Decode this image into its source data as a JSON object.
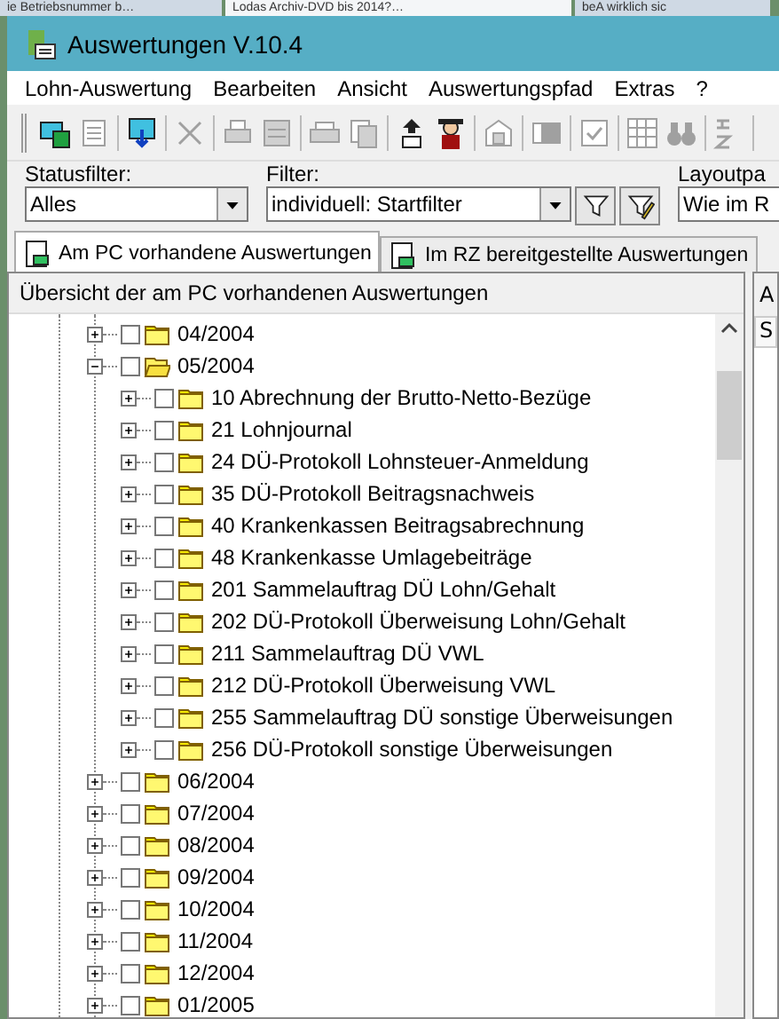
{
  "browser_tabs": [
    {
      "title": "ie Betriebsnummer b…",
      "selected": false
    },
    {
      "title": "Lodas Archiv-DVD bis 2014?…",
      "selected": true
    },
    {
      "title": "beA wirklich sic",
      "selected": false
    }
  ],
  "window": {
    "title": "Auswertungen V.10.4"
  },
  "menu": [
    "Lohn-Auswertung",
    "Bearbeiten",
    "Ansicht",
    "Auswertungspfad",
    "Extras",
    "?"
  ],
  "toolbar": [
    [
      {
        "disabled": false
      },
      {
        "disabled": true
      }
    ],
    [
      {
        "disabled": false
      }
    ],
    [
      {
        "disabled": true
      }
    ],
    [
      {
        "disabled": true
      },
      {
        "disabled": true
      }
    ],
    [
      {
        "disabled": true
      },
      {
        "disabled": true
      }
    ],
    [
      {
        "disabled": false
      },
      {
        "disabled": false
      }
    ],
    [
      {
        "disabled": true
      }
    ],
    [
      {
        "disabled": true
      }
    ],
    [
      {
        "disabled": true
      }
    ],
    [
      {
        "disabled": true
      },
      {
        "disabled": true
      }
    ],
    [
      {
        "disabled": true
      }
    ]
  ],
  "filters": [
    {
      "label": "Statusfilter:",
      "value": "Alles",
      "kind": "combo"
    },
    {
      "label": "Filter:",
      "value": "individuell: Startfilter",
      "kind": "combo-buttons"
    },
    {
      "label": "Layoutpa",
      "value": "Wie im R",
      "kind": "cut"
    }
  ],
  "tabs": [
    {
      "label": "Am PC vorhandene Auswertungen",
      "selected": true
    },
    {
      "label": "Im RZ bereitgestellte Auswertungen",
      "selected": false
    }
  ],
  "tree": {
    "title": "Übersicht der am PC vorhandenen Auswertungen",
    "items": [
      {
        "label": "04/2004",
        "expanded": false,
        "checked": false
      },
      {
        "label": "05/2004",
        "expanded": true,
        "checked": false,
        "children": [
          {
            "label": "10 Abrechnung der Brutto-Netto-Bezüge",
            "expanded": false,
            "checked": false
          },
          {
            "label": "21 Lohnjournal",
            "expanded": false,
            "checked": false
          },
          {
            "label": "24 DÜ-Protokoll Lohnsteuer-Anmeldung",
            "expanded": false,
            "checked": false
          },
          {
            "label": "35 DÜ-Protokoll Beitragsnachweis",
            "expanded": false,
            "checked": false
          },
          {
            "label": "40 Krankenkassen Beitragsabrechnung",
            "expanded": false,
            "checked": false
          },
          {
            "label": "48 Krankenkasse Umlagebeiträge",
            "expanded": false,
            "checked": false
          },
          {
            "label": "201 Sammelauftrag DÜ Lohn/Gehalt",
            "expanded": false,
            "checked": false
          },
          {
            "label": "202 DÜ-Protokoll Überweisung Lohn/Gehalt",
            "expanded": false,
            "checked": false
          },
          {
            "label": "211 Sammelauftrag DÜ VWL",
            "expanded": false,
            "checked": false
          },
          {
            "label": "212 DÜ-Protokoll Überweisung VWL",
            "expanded": false,
            "checked": false
          },
          {
            "label": "255 Sammelauftrag DÜ sonstige Überweisungen",
            "expanded": false,
            "checked": false
          },
          {
            "label": "256 DÜ-Protokoll sonstige Überweisungen",
            "expanded": false,
            "checked": false
          }
        ]
      },
      {
        "label": "06/2004",
        "expanded": false,
        "checked": false
      },
      {
        "label": "07/2004",
        "expanded": false,
        "checked": false
      },
      {
        "label": "08/2004",
        "expanded": false,
        "checked": false
      },
      {
        "label": "09/2004",
        "expanded": false,
        "checked": false
      },
      {
        "label": "10/2004",
        "expanded": false,
        "checked": false
      },
      {
        "label": "11/2004",
        "expanded": false,
        "checked": false
      },
      {
        "label": "12/2004",
        "expanded": false,
        "checked": false
      },
      {
        "label": "01/2005",
        "expanded": false,
        "checked": false
      }
    ]
  },
  "side_panel": {
    "title": "A",
    "column_1": "S"
  }
}
